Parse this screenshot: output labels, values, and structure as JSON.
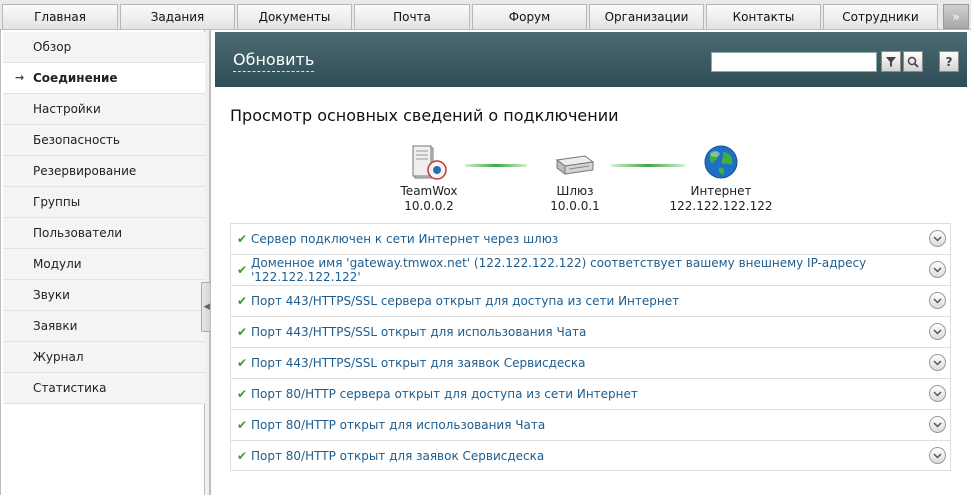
{
  "tabs": [
    {
      "label": "Главная"
    },
    {
      "label": "Задания"
    },
    {
      "label": "Документы"
    },
    {
      "label": "Почта"
    },
    {
      "label": "Форум"
    },
    {
      "label": "Организации"
    },
    {
      "label": "Контакты"
    },
    {
      "label": "Сотрудники"
    }
  ],
  "tabs_more": "»",
  "sidebar": {
    "items": [
      {
        "label": "Обзор",
        "active": false
      },
      {
        "label": "Соединение",
        "active": true
      },
      {
        "label": "Настройки",
        "active": false
      },
      {
        "label": "Безопасность",
        "active": false
      },
      {
        "label": "Резервирование",
        "active": false
      },
      {
        "label": "Группы",
        "active": false
      },
      {
        "label": "Пользователи",
        "active": false
      },
      {
        "label": "Модули",
        "active": false
      },
      {
        "label": "Звуки",
        "active": false
      },
      {
        "label": "Заявки",
        "active": false
      },
      {
        "label": "Журнал",
        "active": false
      },
      {
        "label": "Статистика",
        "active": false
      }
    ],
    "active_marker": "→"
  },
  "toolbar": {
    "refresh_label": "Обновить",
    "search_value": "",
    "help_label": "?"
  },
  "heading": "Просмотр основных сведений о подключении",
  "diagram": {
    "server": {
      "name": "TeamWox",
      "ip": "10.0.0.2"
    },
    "gateway": {
      "name": "Шлюз",
      "ip": "10.0.0.1"
    },
    "internet": {
      "name": "Интернет",
      "ip": "122.122.122.122"
    }
  },
  "checks": [
    {
      "text": "Сервер подключен к сети Интернет через шлюз"
    },
    {
      "text": "Доменное имя 'gateway.tmwox.net' (122.122.122.122) соответствует вашему внешнему IP-адресу '122.122.122.122'"
    },
    {
      "text": "Порт 443/HTTPS/SSL сервера открыт для доступа из сети Интернет"
    },
    {
      "text": "Порт 443/HTTPS/SSL открыт для использования Чата"
    },
    {
      "text": "Порт 443/HTTPS/SSL открыт для заявок Сервисдеска"
    },
    {
      "text": "Порт 80/HTTP сервера открыт для доступа из сети Интернет"
    },
    {
      "text": "Порт 80/HTTP открыт для использования Чата"
    },
    {
      "text": "Порт 80/HTTP открыт для заявок Сервисдеска"
    }
  ],
  "colors": {
    "toolbar": "#3c5a62",
    "link": "#1d5d8f",
    "check": "#3a9a2a"
  }
}
